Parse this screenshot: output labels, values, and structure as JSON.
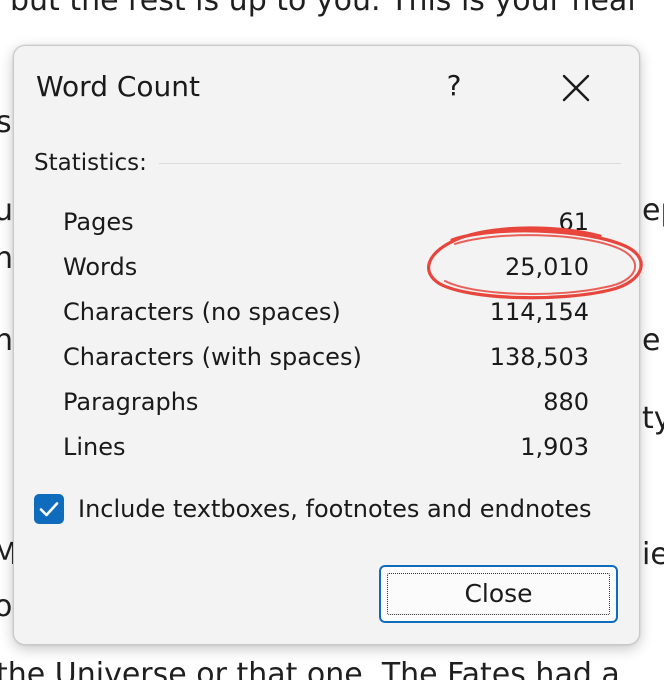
{
  "background": {
    "lines": [
      "but the rest is up to you. This is your heal",
      "s",
      "u",
      "ep",
      "h",
      "h",
      "e t",
      "l",
      "ty",
      "M",
      "ie",
      "o",
      "the Universe or that one. The Fates had a"
    ]
  },
  "dialog": {
    "title": "Word Count",
    "help_label": "?",
    "section_label": "Statistics:",
    "stats": [
      {
        "label": "Pages",
        "value": "61"
      },
      {
        "label": "Words",
        "value": "25,010"
      },
      {
        "label": "Characters (no spaces)",
        "value": "114,154"
      },
      {
        "label": "Characters (with spaces)",
        "value": "138,503"
      },
      {
        "label": "Paragraphs",
        "value": "880"
      },
      {
        "label": "Lines",
        "value": "1,903"
      }
    ],
    "checkbox": {
      "checked": true,
      "label": "Include textboxes, footnotes and endnotes"
    },
    "close_label": "Close"
  },
  "colors": {
    "accent": "#0f6cbd",
    "annotation": "#e8453c",
    "dialog_bg": "#f3f3f3"
  },
  "icons": {
    "close": "close-x-icon",
    "check": "checkmark-icon"
  }
}
